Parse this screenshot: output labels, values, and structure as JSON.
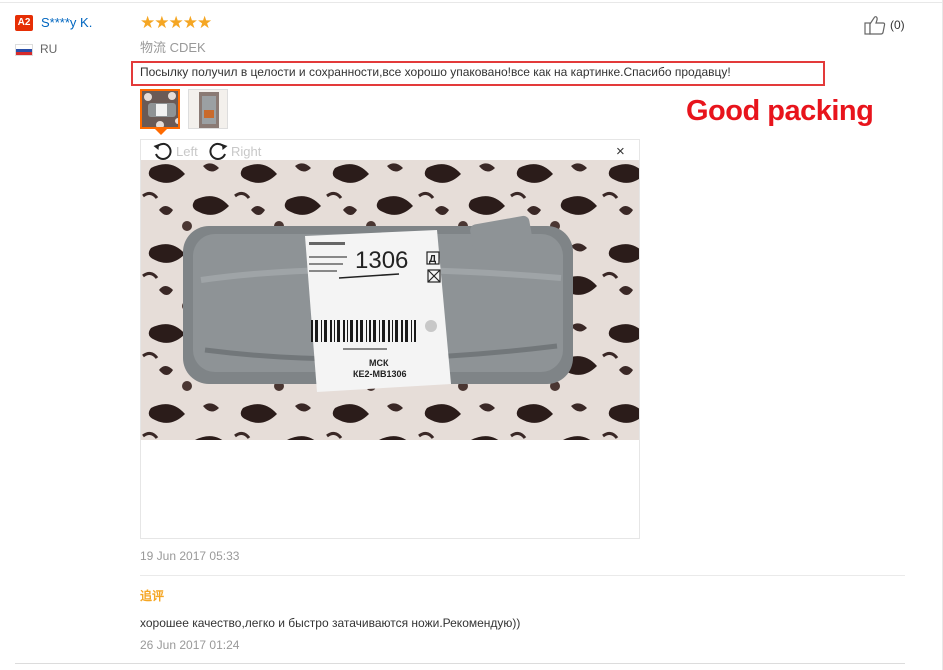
{
  "review": {
    "user_level": "A2",
    "user_name": "S****y K.",
    "country": "RU",
    "stars": "★★★★★",
    "rating": 5,
    "logistics": "物流 CDEK",
    "text": "Посылку получил в целости и сохранности,все хорошо упаковано!все как на картинке.Спасибо продавцу!",
    "like_count": "(0)",
    "date": "19 Jun 2017 05:33"
  },
  "annotation": "Good packing",
  "viewer": {
    "rotate_left_label": "Left",
    "rotate_right_label": "Right",
    "close_symbol": "×",
    "label_number": "1306",
    "label_city": "МСК",
    "label_code": "КЕ2-МВ1306",
    "label_letter": "Д"
  },
  "followup": {
    "title": "追评",
    "text": "хорошее качество,легко и быстро затачиваются ножи.Рекомендую))",
    "date": "26 Jun 2017 01:24"
  },
  "icons": [
    "thumbs-up-icon",
    "rotate-left-icon",
    "rotate-right-icon",
    "close-icon",
    "flag-ru-icon"
  ],
  "colors": {
    "accent": "#ff6a00",
    "star": "#f5a623",
    "link": "#0066c0",
    "annotation": "#e8141c",
    "highlight_box": "#e33a3a"
  }
}
